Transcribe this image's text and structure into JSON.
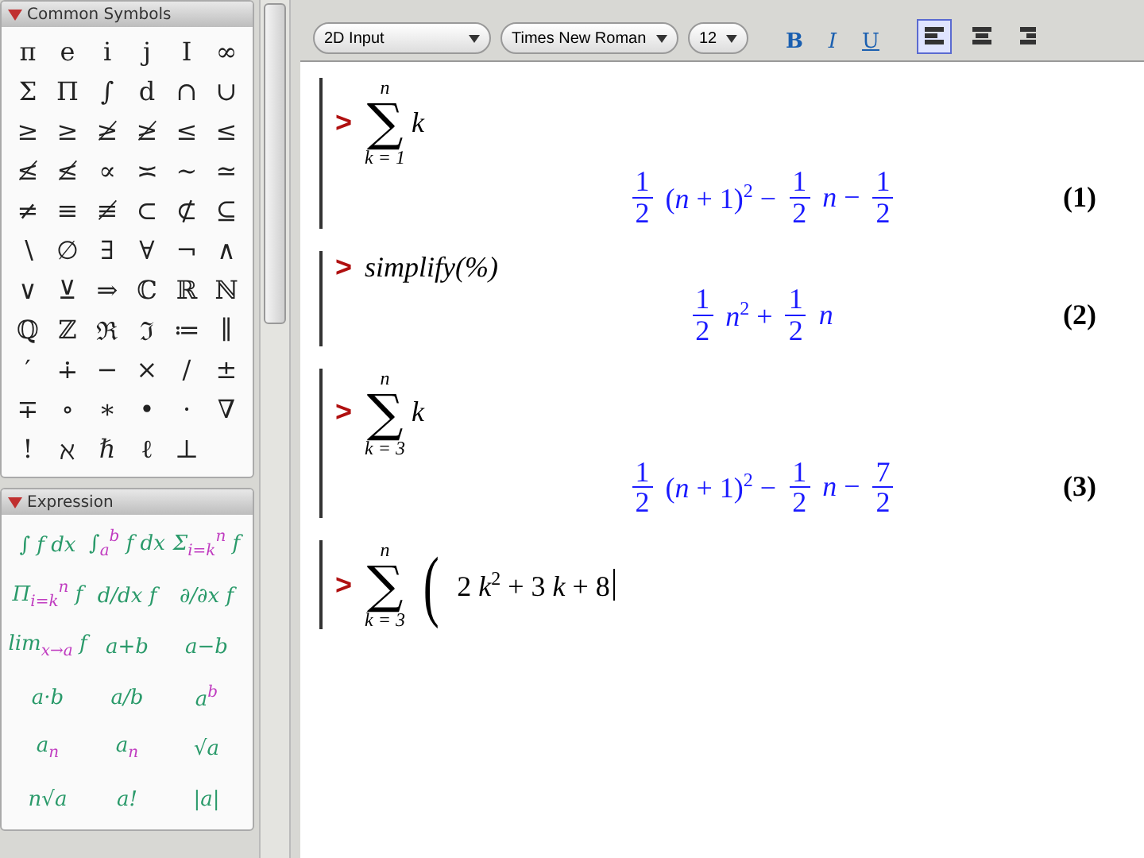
{
  "palettes": [
    {
      "title": "Common Symbols",
      "expanded": true,
      "kind": "symbols",
      "items": [
        "π",
        "e",
        "i",
        "j",
        "I",
        "∞",
        "Σ",
        "Π",
        "∫",
        "d",
        "∩",
        "∪",
        "≥",
        "≥",
        "≱",
        "≱",
        "≤",
        "≤",
        "≰",
        "≰",
        "∝",
        "≍",
        "∼",
        "≃",
        "≠",
        "≡",
        "≢",
        "⊂",
        "⊄",
        "⊆",
        "∖",
        "∅",
        "∃",
        "∀",
        "¬",
        "∧",
        "∨",
        "⊻",
        "⇒",
        "ℂ",
        "ℝ",
        "ℕ",
        "ℚ",
        "ℤ",
        "ℜ",
        "ℑ",
        "≔",
        "∥",
        "′",
        "∔",
        "−",
        "×",
        "/",
        "±",
        "∓",
        "∘",
        "∗",
        "•",
        "·",
        "∇",
        "!",
        "ℵ",
        "ℏ",
        "ℓ",
        "⊥"
      ]
    },
    {
      "title": "Expression",
      "expanded": true,
      "kind": "templates",
      "items": [
        "∫ f dx",
        "∫$_{a}$$^{b}$ f dx",
        "Σ$_{i=k}$$^{n}$ f",
        "Π$_{i=k}$$^{n}$ f",
        "d/dx f",
        "∂/∂x f",
        "lim$_{x→a}$ f",
        "a+b",
        "a−b",
        "a·b",
        "a/b",
        "a$^{b}$",
        "a$_{n}$",
        "*a*$_{n}$",
        "√a",
        "n√a",
        "a!",
        "|a|"
      ]
    }
  ],
  "toolbar": {
    "mode": "2D Input",
    "font": "Times New Roman",
    "size": "12",
    "styles": [
      {
        "label": "B",
        "kind": "bold"
      },
      {
        "label": "I",
        "kind": "italic"
      },
      {
        "label": "U",
        "kind": "underline"
      }
    ],
    "align": [
      {
        "kind": "left",
        "selected": true
      },
      {
        "kind": "center",
        "selected": false
      },
      {
        "kind": "right",
        "selected": false
      }
    ]
  },
  "worksheet": [
    {
      "prompt": ">",
      "input": [
        {
          "kind": "sum",
          "symbol": "∑",
          "upper": "n",
          "lower": "k = 1",
          "body": "k"
        }
      ],
      "output": [
        {
          "kind": "frac",
          "num": "1",
          "den": "2"
        },
        {
          "kind": "text",
          "text": "(*n* + 1)$^{2}$ −"
        },
        {
          "kind": "frac",
          "num": "1",
          "den": "2"
        },
        {
          "kind": "text",
          "text": "*n* −"
        },
        {
          "kind": "frac",
          "num": "1",
          "den": "2"
        }
      ],
      "label": "(1)"
    },
    {
      "prompt": ">",
      "input": [
        {
          "kind": "text",
          "text": "simplify(%)"
        }
      ],
      "output": [
        {
          "kind": "frac",
          "num": "1",
          "den": "2"
        },
        {
          "kind": "text",
          "text": "*n*$^{2}$ +"
        },
        {
          "kind": "frac",
          "num": "1",
          "den": "2"
        },
        {
          "kind": "text",
          "text": "*n*"
        }
      ],
      "label": "(2)"
    },
    {
      "prompt": ">",
      "input": [
        {
          "kind": "sum",
          "symbol": "∑",
          "upper": "n",
          "lower": "k = 3",
          "body": "k"
        }
      ],
      "output": [
        {
          "kind": "frac",
          "num": "1",
          "den": "2"
        },
        {
          "kind": "text",
          "text": "(*n* + 1)$^{2}$ −"
        },
        {
          "kind": "frac",
          "num": "1",
          "den": "2"
        },
        {
          "kind": "text",
          "text": "*n* −"
        },
        {
          "kind": "frac",
          "num": "7",
          "den": "2"
        }
      ],
      "label": "(3)"
    },
    {
      "prompt": ">",
      "input": [
        {
          "kind": "sum",
          "symbol": "∑",
          "upper": "n",
          "lower": "k = 3"
        },
        {
          "kind": "paren",
          "text": "("
        },
        {
          "kind": "expr",
          "text": "2 *k*$^{2}$ + 3 *k* + 8"
        }
      ],
      "cursor": true
    }
  ]
}
